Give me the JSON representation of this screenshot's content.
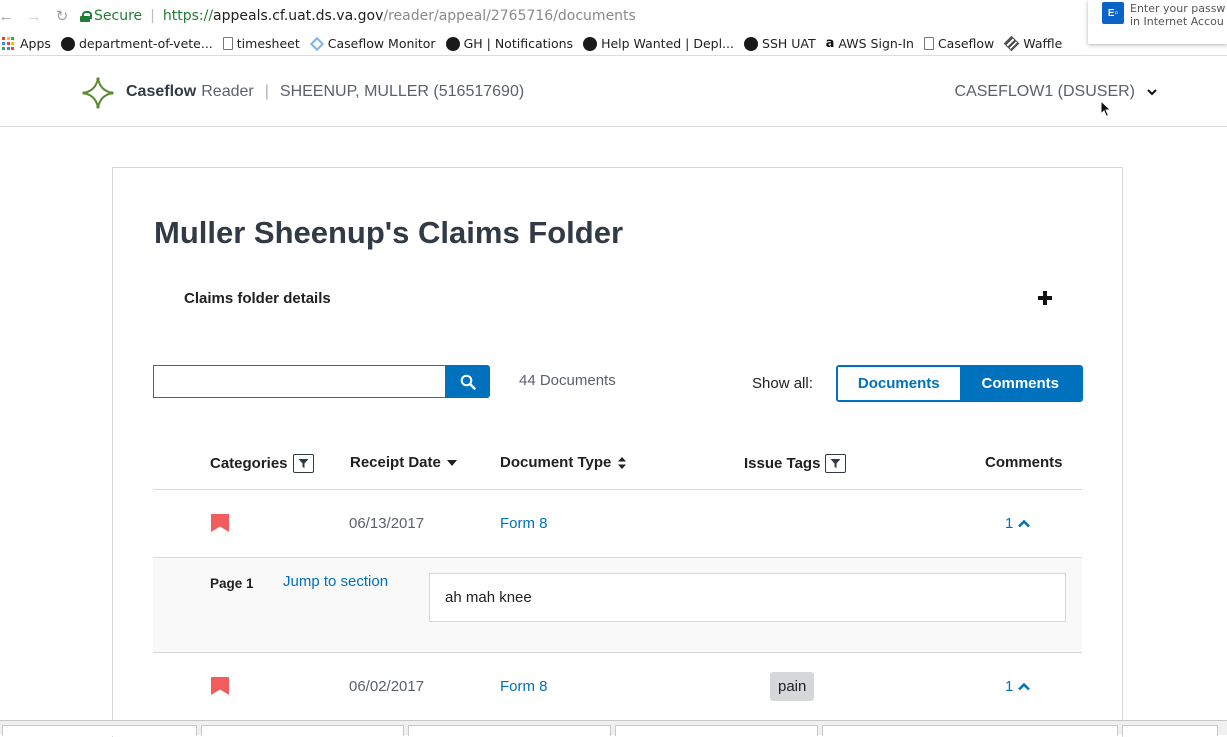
{
  "browser": {
    "secure_label": "Secure",
    "url_scheme": "https://",
    "url_host": "appeals.cf.uat.ds.va.gov",
    "url_path": "/reader/appeal/2765716/documents",
    "notification": {
      "line1": "Enter your passw",
      "line2": "in Internet Accou"
    },
    "bookmarks": [
      {
        "label": "Apps",
        "icon": "apps-grid-icon"
      },
      {
        "label": "department-of-vete...",
        "icon": "github-icon"
      },
      {
        "label": "timesheet",
        "icon": "document-icon"
      },
      {
        "label": "Caseflow Monitor",
        "icon": "diamond-icon"
      },
      {
        "label": "GH | Notifications",
        "icon": "github-icon"
      },
      {
        "label": "Help Wanted | Depl...",
        "icon": "github-icon"
      },
      {
        "label": "SSH UAT",
        "icon": "github-icon"
      },
      {
        "label": "AWS Sign-In",
        "icon": "amazon-icon"
      },
      {
        "label": "Caseflow",
        "icon": "document-icon"
      },
      {
        "label": "Waffle",
        "icon": "waffle-icon"
      }
    ]
  },
  "header": {
    "app_name": "Caseflow",
    "app_sub": "Reader",
    "separator": "|",
    "veteran": "SHEENUP, MULLER (516517690)",
    "user": "CASEFLOW1 (DSUSER)"
  },
  "main": {
    "title": "Muller Sheenup's Claims Folder",
    "details_label": "Claims folder details",
    "search_placeholder": "",
    "doc_count": "44 Documents",
    "show_all_label": "Show all:",
    "toggle_documents": "Documents",
    "toggle_comments": "Comments",
    "active_toggle": "Comments"
  },
  "table": {
    "headers": {
      "categories": "Categories",
      "receipt_date": "Receipt Date",
      "document_type": "Document Type",
      "issue_tags": "Issue Tags",
      "comments": "Comments"
    },
    "rows": [
      {
        "date": "06/13/2017",
        "type": "Form 8",
        "tags": [],
        "comments": "1",
        "comment_detail": {
          "page_label": "Page 1",
          "jump_label": "Jump to section",
          "text": "ah mah knee"
        }
      },
      {
        "date": "06/02/2017",
        "type": "Form 8",
        "tags": [
          "pain"
        ],
        "comments": "1"
      }
    ]
  },
  "colors": {
    "primary": "#0071bc",
    "bookmark": "#f15c5c",
    "title": "#323a45",
    "logo_green": "#5a8a2e"
  }
}
